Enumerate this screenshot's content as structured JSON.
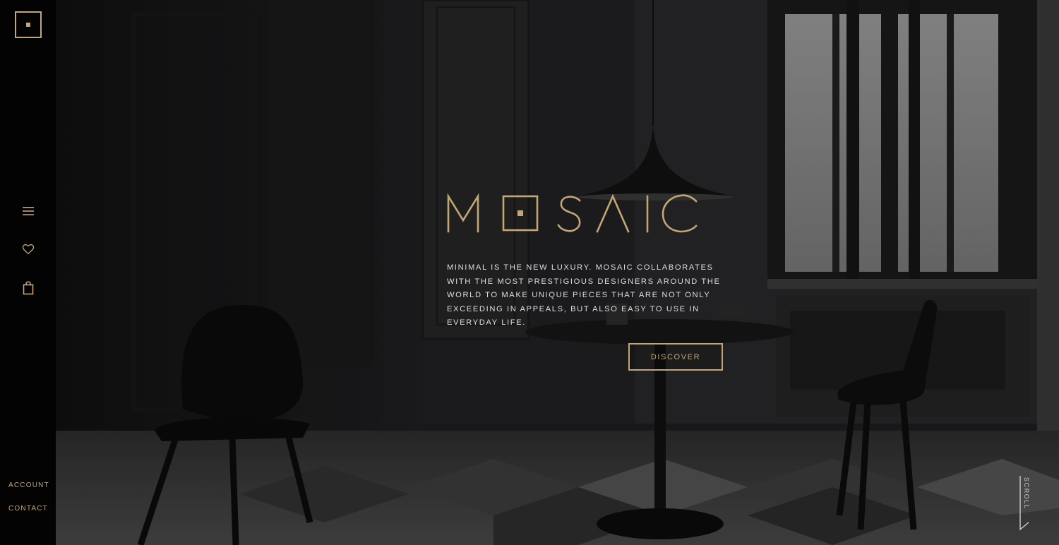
{
  "brand": {
    "name": "MOSAIC",
    "accent": "#c2a775"
  },
  "sidebar": {
    "icons": [
      "menu-icon",
      "heart-icon",
      "shopping-bag-icon"
    ],
    "links": [
      "ACCOUNT",
      "CONTACT"
    ]
  },
  "hero": {
    "tagline": "MINIMAL IS THE NEW LUXURY. MOSAIC COLLABORATES WITH THE MOST PRESTIGIOUS DESIGNERS AROUND THE WORLD TO MAKE UNIQUE PIECES THAT ARE NOT ONLY EXCEEDING IN APPEALS, BUT ALSO EASY TO USE IN EVERYDAY LIFE.",
    "cta": "DISCOVER",
    "scroll_label": "SCROLL"
  }
}
